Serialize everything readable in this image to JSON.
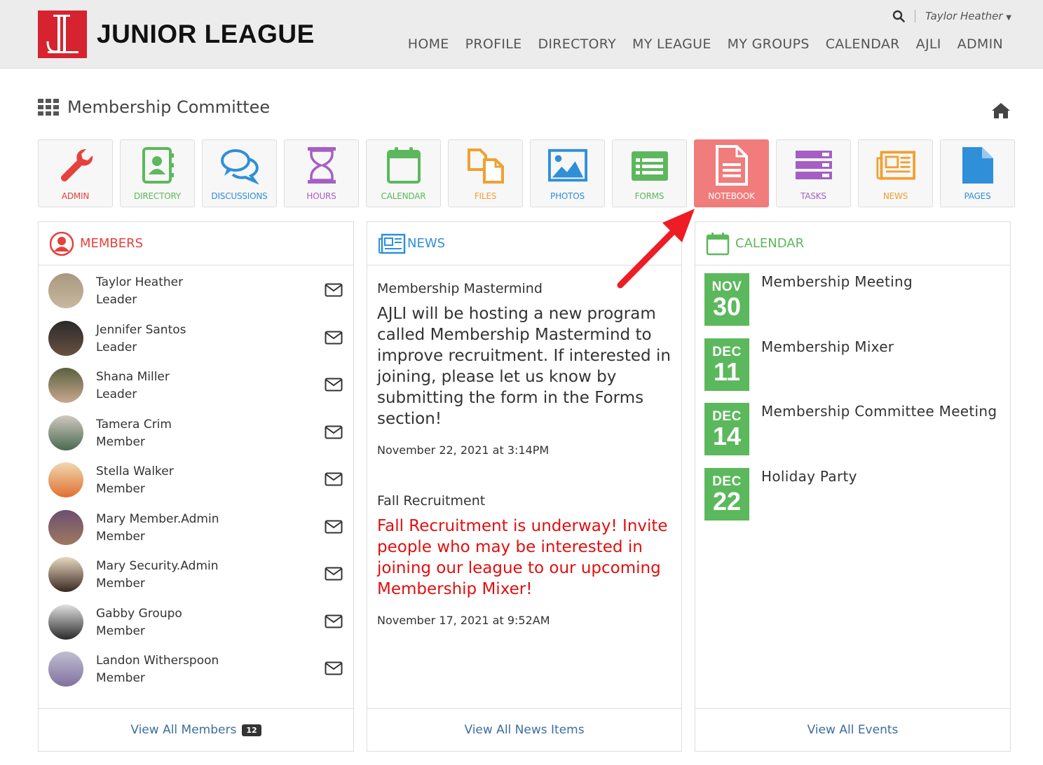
{
  "header": {
    "logo_text": "JUNIOR LEAGUE",
    "user_name": "Taylor Heather",
    "nav": [
      "HOME",
      "PROFILE",
      "DIRECTORY",
      "MY LEAGUE",
      "MY GROUPS",
      "CALENDAR",
      "AJLI",
      "ADMIN"
    ]
  },
  "page": {
    "title": "Membership Committee"
  },
  "tiles": [
    {
      "label": "ADMIN",
      "color": "#e5413d",
      "icon": "wrench-icon"
    },
    {
      "label": "DIRECTORY",
      "color": "#5cb85c",
      "icon": "contact-book-icon"
    },
    {
      "label": "DISCUSSIONS",
      "color": "#2f8fd8",
      "icon": "chat-bubbles-icon"
    },
    {
      "label": "HOURS",
      "color": "#a55fc4",
      "icon": "hourglass-icon"
    },
    {
      "label": "CALENDAR",
      "color": "#5cb85c",
      "icon": "calendar-icon"
    },
    {
      "label": "FILES",
      "color": "#f0a030",
      "icon": "files-icon"
    },
    {
      "label": "PHOTOS",
      "color": "#2f8fd8",
      "icon": "photo-icon"
    },
    {
      "label": "FORMS",
      "color": "#5cb85c",
      "icon": "form-icon"
    },
    {
      "label": "NOTEBOOK",
      "color": "#ffffff",
      "icon": "notebook-icon"
    },
    {
      "label": "TASKS",
      "color": "#a55fc4",
      "icon": "tasks-icon"
    },
    {
      "label": "NEWS",
      "color": "#f0a030",
      "icon": "newspaper-icon"
    },
    {
      "label": "PAGES",
      "color": "#2f8fd8",
      "icon": "page-icon"
    }
  ],
  "members_panel": {
    "title": "MEMBERS",
    "members": [
      {
        "name": "Taylor Heather",
        "role": "Leader"
      },
      {
        "name": "Jennifer Santos",
        "role": "Leader"
      },
      {
        "name": "Shana Miller",
        "role": "Leader"
      },
      {
        "name": "Tamera Crim",
        "role": "Member"
      },
      {
        "name": "Stella Walker",
        "role": "Member"
      },
      {
        "name": "Mary Member.Admin",
        "role": "Member"
      },
      {
        "name": "Mary Security.Admin",
        "role": "Member"
      },
      {
        "name": "Gabby Groupo",
        "role": "Member"
      },
      {
        "name": "Landon Witherspoon",
        "role": "Member"
      }
    ],
    "view_all": "View All Members",
    "count": "12"
  },
  "news_panel": {
    "title": "NEWS",
    "items": [
      {
        "title": "Membership Mastermind",
        "body": "AJLI will be hosting a new program called Membership Mastermind to improve recruitment. If interested in joining, please let us know by submitting the form in the Forms section!",
        "date": "November 22, 2021 at 3:14PM"
      },
      {
        "title": "Fall Recruitment",
        "body": "Fall Recruitment is underway! Invite people who may be interested in joining our league to our upcoming Membership Mixer!",
        "date": "November 17, 2021 at 9:52AM"
      }
    ],
    "view_all": "View All News Items"
  },
  "calendar_panel": {
    "title": "CALENDAR",
    "events": [
      {
        "month": "NOV",
        "day": "30",
        "title": "Membership Meeting"
      },
      {
        "month": "DEC",
        "day": "11",
        "title": "Membership Mixer"
      },
      {
        "month": "DEC",
        "day": "14",
        "title": "Membership Committee Meeting"
      },
      {
        "month": "DEC",
        "day": "22",
        "title": "Holiday Party"
      }
    ],
    "view_all": "View All Events"
  },
  "colors": {
    "brand_red": "#d6232f",
    "members_red": "#e5413d",
    "news_blue": "#2f8fd8",
    "calendar_green": "#5cb85c",
    "notebook_active": "#f17c7c",
    "arrow_red": "#ee1c24"
  }
}
